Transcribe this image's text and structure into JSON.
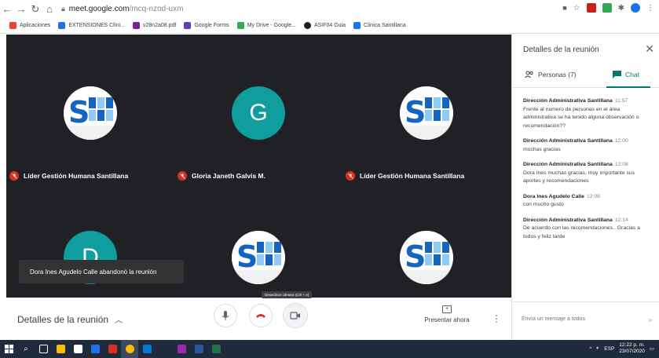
{
  "browser": {
    "url_host": "meet.google.com",
    "url_path": "/mcq-nzod-uxm",
    "bookmarks": [
      {
        "label": "Aplicaciones",
        "color": "#ea4335"
      },
      {
        "label": "EXTENSIONES Clíni...",
        "color": "#1a73e8"
      },
      {
        "label": "v28n2a08.pdf",
        "color": "#7b1fa2"
      },
      {
        "label": "Google Forms",
        "color": "#673ab7"
      },
      {
        "label": "My Drive - Google...",
        "color": "#34a853"
      },
      {
        "label": "ASIF04 Guia",
        "color": "#202124"
      },
      {
        "label": "Clinica Santillana",
        "color": "#1a73e8"
      }
    ]
  },
  "meeting": {
    "tiles": [
      {
        "name": "Líder Gestión Humana Santillana",
        "avatar": "logo"
      },
      {
        "name": "Gloria Janeth Galvis M.",
        "avatar": "letter",
        "letter": "G"
      },
      {
        "name": "Líder Gestión Humana Santillana",
        "avatar": "logo"
      },
      {
        "name": "",
        "avatar": "letter",
        "letter": "D"
      },
      {
        "name": "",
        "avatar": "logo"
      },
      {
        "name": "",
        "avatar": "logo"
      }
    ],
    "toast": "Dora Ines Agudelo Calle abandonó la reunión"
  },
  "bottombar": {
    "details_label": "Detalles de la reunión",
    "camera_tooltip": "Desactivar cámara (Ctrl + e)",
    "present_label": "Presentar ahora"
  },
  "panel": {
    "title": "Detalles de la reunión",
    "tab_people": "Personas (7)",
    "tab_chat": "Chat",
    "messages": [
      {
        "sender": "Dirección Administrativa Santillana",
        "time": "11:57",
        "text": "Frente al numero de personas en el área administrativa se ha tenido alguna observación o recomendación??"
      },
      {
        "sender": "Dirección Administrativa Santillana",
        "time": "12:00",
        "text": "muchas gracias"
      },
      {
        "sender": "Dirección Administrativa Santillana",
        "time": "12:08",
        "text": "Dora Ines muchas gracias, muy importante sus aportes y recomendaciones"
      },
      {
        "sender": "Dora Ines Agudelo Calle",
        "time": "12:08",
        "text": "con mucho gusto"
      },
      {
        "sender": "Dirección Administrativa Santillana",
        "time": "12:14",
        "text": "De acuerdo con las recomendaciones.. Gracias a todos y feliz tarde"
      }
    ],
    "compose_placeholder": "Envía un mensaje a todos"
  },
  "taskbar": {
    "lang": "ESP",
    "time": "12:22 p. m.",
    "date": "23/07/2020"
  }
}
